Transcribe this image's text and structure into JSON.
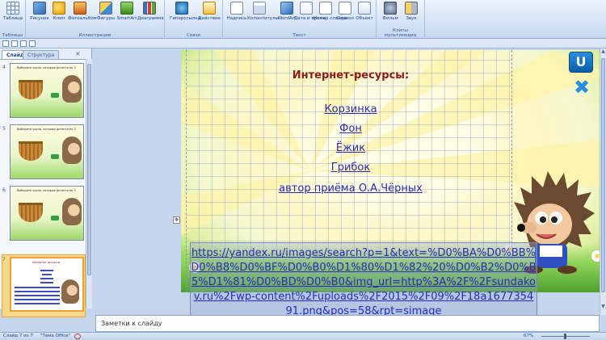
{
  "ribbon": {
    "groups": [
      {
        "label": "Таблицы",
        "buttons": [
          {
            "label": "Таблица",
            "icon": "table-icon"
          }
        ]
      },
      {
        "label": "Иллюстрации",
        "buttons": [
          {
            "label": "Рисунок",
            "icon": "picture-icon"
          },
          {
            "label": "Клип",
            "icon": "clipart-icon"
          },
          {
            "label": "Фотоальбом",
            "icon": "photo-album-icon"
          },
          {
            "label": "Фигуры",
            "icon": "shapes-icon"
          },
          {
            "label": "SmartArt",
            "icon": "smartart-icon"
          },
          {
            "label": "Диаграмма",
            "icon": "chart-icon"
          }
        ]
      },
      {
        "label": "Связи",
        "buttons": [
          {
            "label": "Гиперссылка",
            "icon": "hyperlink-icon"
          },
          {
            "label": "Действие",
            "icon": "action-icon"
          }
        ]
      },
      {
        "label": "Текст",
        "buttons": [
          {
            "label": "Надпись",
            "icon": "textbox-icon"
          },
          {
            "label": "Колонтитулы",
            "icon": "header-footer-icon"
          },
          {
            "label": "WordArt",
            "icon": "wordart-icon"
          },
          {
            "label": "Дата и время",
            "icon": "date-time-icon"
          },
          {
            "label": "Номер слайда",
            "icon": "slide-number-icon"
          },
          {
            "label": "Символ",
            "icon": "symbol-icon"
          },
          {
            "label": "Объект",
            "icon": "object-icon"
          }
        ]
      },
      {
        "label": "Клипы мультимедиа",
        "buttons": [
          {
            "label": "Фильм",
            "icon": "film-icon"
          },
          {
            "label": "Звук",
            "icon": "sound-icon"
          }
        ]
      }
    ]
  },
  "panel": {
    "tab_slides": "Слайды",
    "tab_structure": "Структура",
    "close": "×",
    "thumbs": [
      {
        "num": "4",
        "title": "Выберите числа, которые делятся на 3"
      },
      {
        "num": "5",
        "title": "Выберите числа, которые делятся на 3"
      },
      {
        "num": "6",
        "title": "Выберите числа, которые делятся на 3"
      },
      {
        "num": "7",
        "title": "Интернет-ресурсы"
      }
    ]
  },
  "slide": {
    "title": "Интернет-ресурсы:",
    "links": [
      "Корзинка",
      "Фон",
      "Ёжик",
      "Грибок"
    ],
    "author": "автор приёма О.А.Чёрных",
    "url": "https://yandex.ru/images/search?p=1&text=%D0%BA%D0%BB%D0%B8%D0%BF%D0%B0%D1%80%D1%82%20%D0%B2%D0%B5%D1%81%D0%BD%D0%B0&img_url=http%3A%2F%2Fsundakov.ru%2Fwp-content%2Fuploads%2F2015%2F09%2F18a167735491.png&pos=58&rpt=simage",
    "btn_return": "U",
    "btn_close": "✖",
    "move_handle": "✥"
  },
  "notes": {
    "placeholder": "Заметки к слайду"
  },
  "status": {
    "slide": "Слайд 7 из 7",
    "theme": "\"Тема Office\"",
    "zoom": "67%"
  },
  "colors": {
    "title": "#8b1a1a",
    "link": "#2b2bb5",
    "accent": "#2a8ee0"
  }
}
